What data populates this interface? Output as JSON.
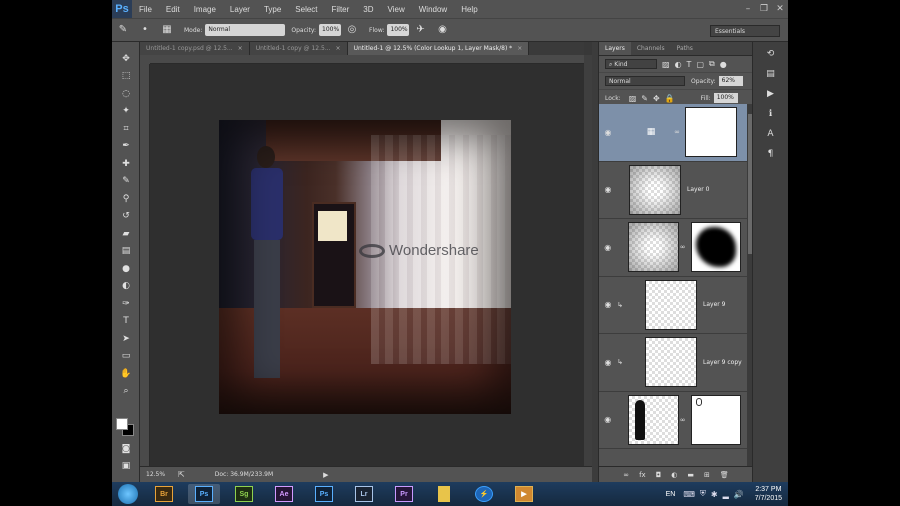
{
  "app": {
    "logo": "Ps"
  },
  "menu": [
    "File",
    "Edit",
    "Image",
    "Layer",
    "Type",
    "Select",
    "Filter",
    "3D",
    "View",
    "Window",
    "Help"
  ],
  "options": {
    "mode_label": "Mode:",
    "mode_value": "Normal",
    "opacity_label": "Opacity:",
    "opacity_value": "100%",
    "flow_label": "Flow:",
    "flow_value": "100%",
    "workspace": "Essentials"
  },
  "tabs": [
    {
      "label": "Untitled-1 copy.psd @ 12.5..."
    },
    {
      "label": "Untitled-1 copy @ 12.5..."
    },
    {
      "label": "Untitled-1 @ 12.5% (Color Lookup 1, Layer Mask/8) *"
    }
  ],
  "watermark": "Wondershare",
  "status": {
    "zoom": "12.5%",
    "docsize": "Doc: 36.9M/233.9M"
  },
  "panel": {
    "tabs": [
      "Layers",
      "Channels",
      "Paths"
    ],
    "filter_kind": "Kind",
    "blend_mode": "Normal",
    "opacity_label": "Opacity:",
    "opacity_value": "62%",
    "lock_label": "Lock:",
    "fill_label": "Fill:",
    "fill_value": "100%"
  },
  "layers": [
    {
      "name": ""
    },
    {
      "name": "Layer 0"
    },
    {
      "name": ""
    },
    {
      "name": "Layer 9"
    },
    {
      "name": "Layer 9 copy"
    },
    {
      "name": ""
    }
  ],
  "taskbar": {
    "apps": [
      {
        "label": "Br",
        "color": "#e8a33a"
      },
      {
        "label": "Ps",
        "color": "#5ab0ff"
      },
      {
        "label": "Sg",
        "color": "#8fd14f"
      },
      {
        "label": "Ae",
        "color": "#d39aff"
      },
      {
        "label": "Ps",
        "color": "#5ab0ff"
      },
      {
        "label": "Lr",
        "color": "#a9c4e8"
      },
      {
        "label": "Pr",
        "color": "#c99aff"
      }
    ],
    "lang": "EN",
    "time": "2:37 PM",
    "date": "7/7/2015"
  }
}
